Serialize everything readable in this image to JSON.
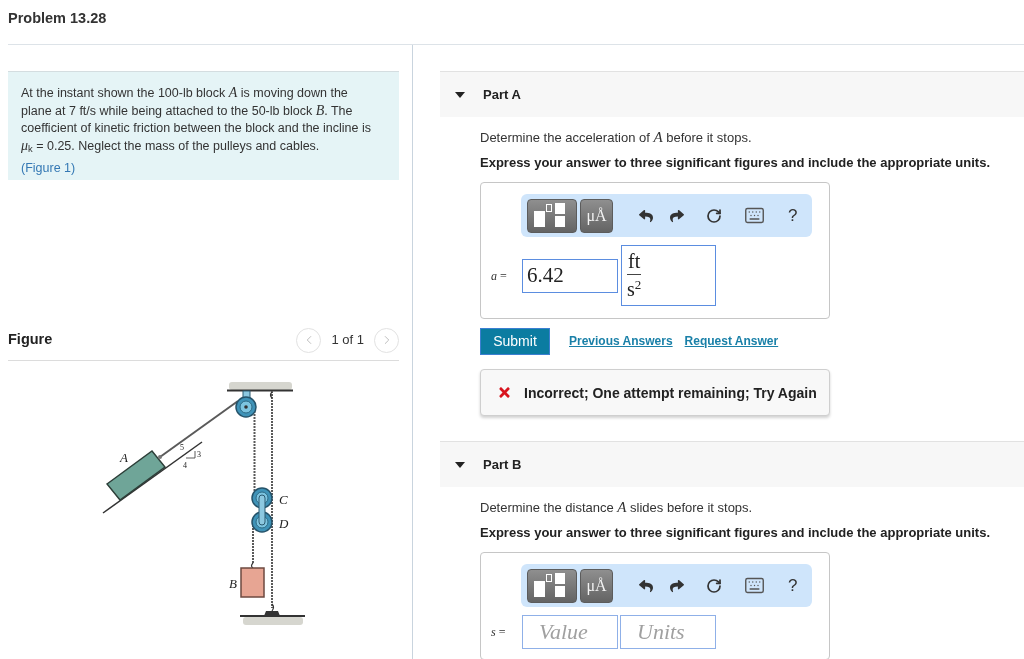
{
  "title": "Problem 13.28",
  "problem": {
    "text": "At the instant shown the 100-lb block *A* is moving down the plane at 7  ft/s while being attached to the 50-lb block *B*. The coefficient of kinetic friction between the block and the incline is *μ*$_{k}$ = 0.25. Neglect the mass of the pulleys and cables.",
    "figure_link": "(Figure 1)"
  },
  "figure": {
    "title": "Figure",
    "pager": {
      "text": "1 of 1",
      "previous": {
        "disabled": true
      },
      "next": {
        "disabled": true
      }
    },
    "labels": [
      "A",
      "5",
      "3",
      "4",
      "C",
      "D",
      "B"
    ]
  },
  "parts": [
    {
      "label": "Part A",
      "expanded": true,
      "question": "Determine the acceleration of *A* before it stops.",
      "instruction": "Express your answer to three significant figures and include the appropriate units.",
      "toolbar": {
        "units_button": "μÅ",
        "help_button": "?"
      },
      "variable": "*a* =",
      "value": "6.42",
      "units": {
        "numerator": "ft",
        "denominator": "s$^{2}$"
      },
      "actions": {
        "submit": "Submit",
        "links": [
          "Previous Answers",
          "Request Answer"
        ]
      },
      "feedback": {
        "kind": "incorrect",
        "text": "Incorrect; One attempt remaining; Try Again"
      }
    },
    {
      "label": "Part B",
      "expanded": true,
      "question": "Determine the distance *A* slides before it stops.",
      "instruction": "Express your answer to three significant figures and include the appropriate units.",
      "toolbar": {
        "units_button": "μÅ",
        "help_button": "?"
      },
      "variable": "*s* =",
      "value_placeholder": "Value",
      "units_placeholder": "Units"
    }
  ]
}
